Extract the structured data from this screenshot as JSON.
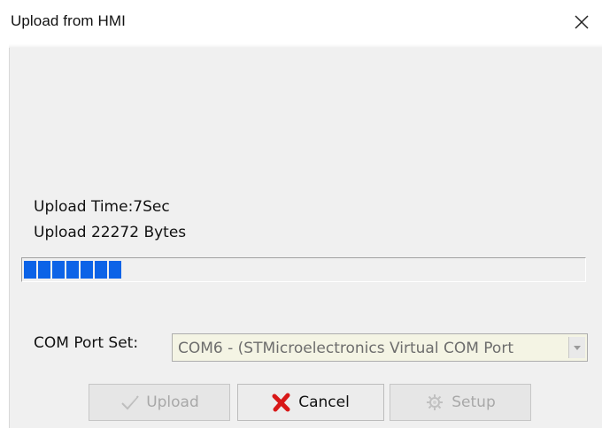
{
  "window": {
    "title": "Upload from HMI",
    "close_icon": "close-icon"
  },
  "status": {
    "upload_time": "Upload Time:7Sec",
    "upload_bytes": "Upload 22272 Bytes"
  },
  "progress": {
    "filled_blocks": 7,
    "color": "#0c63e7"
  },
  "com_port": {
    "label": "COM Port Set:",
    "selected_value": "COM6 - (STMicroelectronics Virtual COM Port"
  },
  "buttons": {
    "upload": {
      "label": "Upload",
      "icon": "checkmark-icon",
      "enabled": false
    },
    "cancel": {
      "label": "Cancel",
      "icon": "red-x-icon",
      "enabled": true
    },
    "setup": {
      "label": "Setup",
      "icon": "gear-icon",
      "enabled": false
    }
  },
  "colors": {
    "cancel_icon": "#d81818",
    "dialog_bg": "#f0f0f0",
    "combo_bg": "#f4f4e4"
  }
}
